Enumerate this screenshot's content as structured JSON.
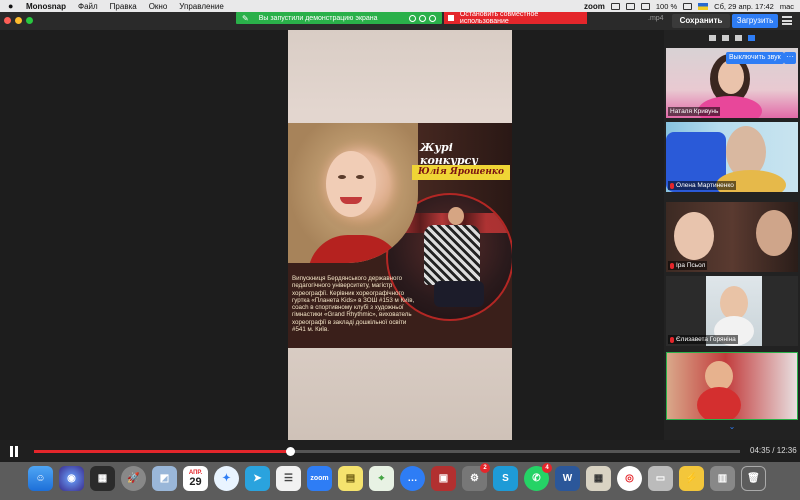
{
  "menubar": {
    "app_name": "Monosnap",
    "menus": [
      "Файл",
      "Правка",
      "Окно",
      "Управление"
    ],
    "zoom_label": "zoom",
    "battery": "100 %",
    "datetime": "Сб, 29 апр. 17:42",
    "user": "mac"
  },
  "share_banner": {
    "text": "Вы запустили демонстрацию экрана",
    "stop_label": "Остановить совместное использование"
  },
  "toolbar": {
    "filename_ext": ".mp4",
    "save_label": "Сохранить",
    "upload_label": "Загрузить"
  },
  "poster": {
    "jury_title": "Журі конкурсу",
    "name": "Юлія Ярошенко",
    "bio": "Випускниця Бердянського державного педагогічного університету, магістр хореографії. Керівник хореографічного гуртка «Планета Kids» в ЗОШ #153 м Київ, coach в спортивному клубі з художньої гімнастики «Grand Rhythmic», вихователь хореографії в закладі дошкільної освіти #541 м. Київ."
  },
  "participants": {
    "mute_button": "Выключить звук",
    "more_label": "···",
    "tiles": [
      {
        "name": "Наталя Кривунь"
      },
      {
        "name": "Олена Мартиненко"
      },
      {
        "name": "Іра Псьол"
      },
      {
        "name": "Єлизавета Горяніна"
      },
      {
        "name": ""
      }
    ],
    "more_arrow": "⌄"
  },
  "player": {
    "progress": 0.362,
    "time": "04:35 / 12:36"
  },
  "dock": {
    "calendar_month": "АПР.",
    "calendar_day": "29",
    "badge_a": "2",
    "badge_b": "4"
  },
  "colors": {
    "accent_blue": "#2e7df5",
    "share_green": "#2ab04a",
    "stop_red": "#e4262b"
  }
}
